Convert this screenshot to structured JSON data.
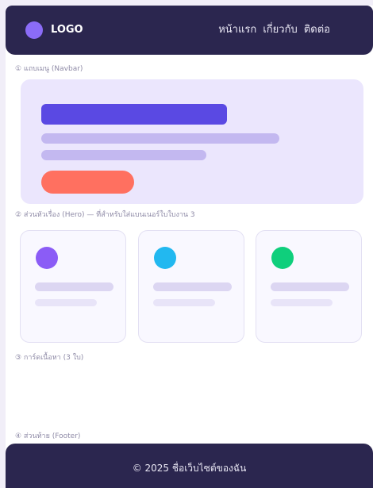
{
  "navbar": {
    "logo_label": "LOGO",
    "links": [
      "หน้าแรก",
      "เกี่ยวกับ",
      "ติดต่อ"
    ]
  },
  "sections": {
    "navbar_label": "① แถบเมนู (Navbar)",
    "hero_label": "② ส่วนหัวเรื่อง (Hero) — ที่สำหรับใส่แบนเนอร์ใบใบงาน 3",
    "cards_label": "③ การ์ดเนื้อหา (3 ใบ)",
    "footer_label": "④ ส่วนท้าย (Footer)"
  },
  "cards": [
    {
      "icon": "purple-circle-icon",
      "color": "#8b5cf6"
    },
    {
      "icon": "blue-circle-icon",
      "color": "#22b8f0"
    },
    {
      "icon": "green-circle-icon",
      "color": "#0fcf7c"
    }
  ],
  "footer": {
    "text": "© 2025 ชื่อเว็บไซต์ของฉัน"
  },
  "colors": {
    "navbar_bg": "#2b264f",
    "hero_bg": "#ebe6fd",
    "hero_title": "#5a49e3",
    "hero_button": "#ff7060"
  }
}
